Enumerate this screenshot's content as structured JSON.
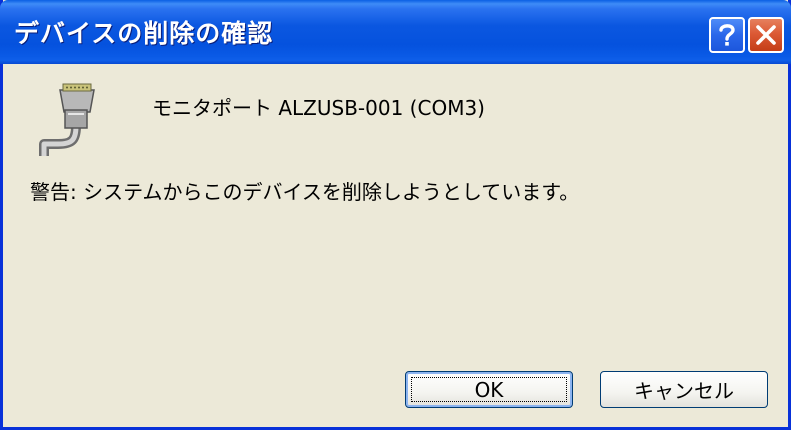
{
  "window": {
    "title": "デバイスの削除の確認",
    "help_icon": "question-mark-icon",
    "close_icon": "close-x-icon"
  },
  "device": {
    "icon": "serial-port-icon",
    "name": "モニタポート ALZUSB-001 (COM3)"
  },
  "warning": "警告: システムからこのデバイスを削除しようとしています。",
  "buttons": {
    "ok_label": "OK",
    "cancel_label": "キャンセル"
  },
  "colors": {
    "titlebar": "#0552de",
    "dialog_bg": "#ece9d8",
    "close_button": "#dc5a35"
  }
}
